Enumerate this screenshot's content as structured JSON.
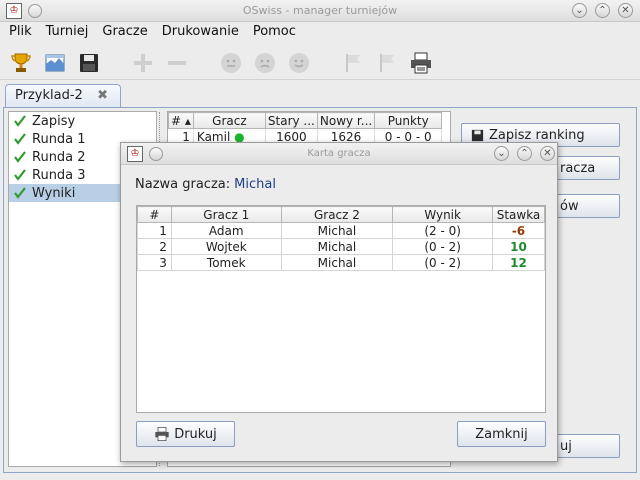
{
  "window": {
    "title": "OSwiss - manager turniejów"
  },
  "menu": [
    "Plik",
    "Turniej",
    "Gracze",
    "Drukowanie",
    "Pomoc"
  ],
  "tab": {
    "label": "Przyklad-2"
  },
  "tree": [
    "Zapisy",
    "Runda 1",
    "Runda 2",
    "Runda 3",
    "Wyniki"
  ],
  "tree_selected": 4,
  "bg_table": {
    "headers": [
      "#",
      "Gracz",
      "Stary ...",
      "Nowy r...",
      "Punkty"
    ],
    "rows": [
      [
        "1",
        "Kamil",
        "1600",
        "1626",
        "0 - 0 - 0"
      ]
    ]
  },
  "side_buttons": {
    "save_ranking": "Zapisz ranking",
    "players": "racza",
    "other": "ów",
    "print": "uj"
  },
  "dialog": {
    "title": "Karta gracza",
    "name_label": "Nazwa gracza:",
    "name_value": "Michal",
    "headers": [
      "#",
      "Gracz 1",
      "Gracz 2",
      "Wynik",
      "Stawka"
    ],
    "rows": [
      [
        "1",
        "Adam",
        "Michal",
        "(2 - 0)",
        "-6"
      ],
      [
        "2",
        "Wojtek",
        "Michal",
        "(0 - 2)",
        "10"
      ],
      [
        "3",
        "Tomek",
        "Michal",
        "(0 - 2)",
        "12"
      ]
    ],
    "print_label": "Drukuj",
    "close_label": "Zamknij"
  },
  "colors": {
    "stake_negative": "#9a3a0a",
    "stake_positive": "#1e8c2e",
    "name_value": "#1d3f85"
  }
}
